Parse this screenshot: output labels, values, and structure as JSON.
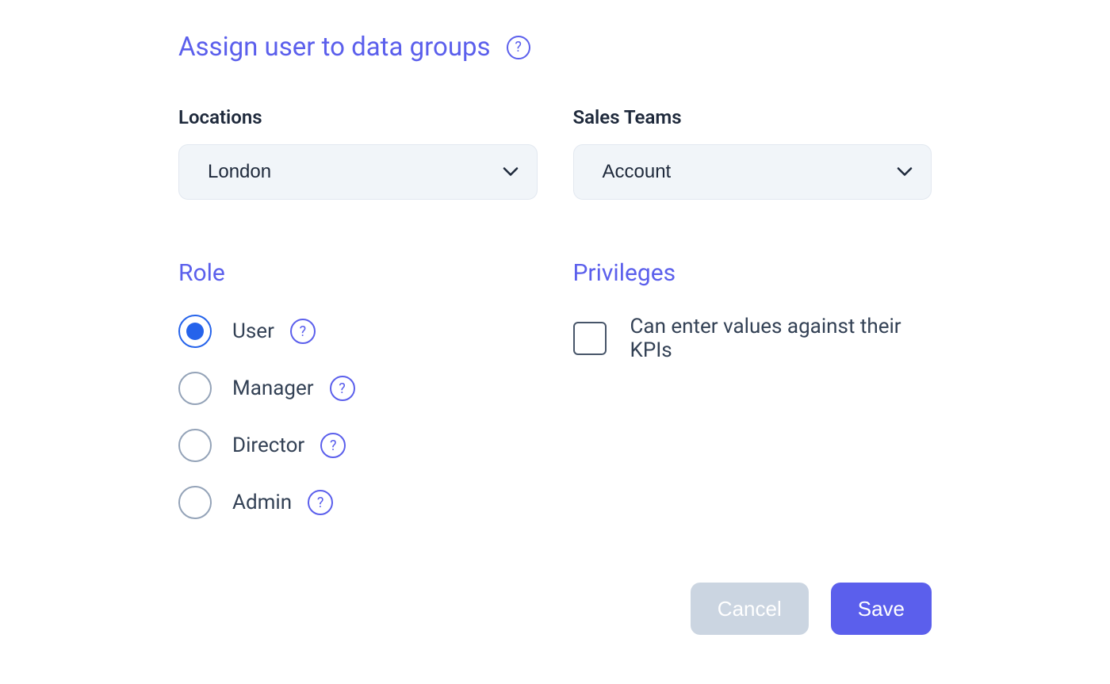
{
  "header": {
    "title": "Assign user to data groups"
  },
  "fields": {
    "locations": {
      "label": "Locations",
      "value": "London"
    },
    "salesTeams": {
      "label": "Sales Teams",
      "value": "Account"
    }
  },
  "role": {
    "title": "Role",
    "options": [
      {
        "label": "User",
        "selected": true
      },
      {
        "label": "Manager",
        "selected": false
      },
      {
        "label": "Director",
        "selected": false
      },
      {
        "label": "Admin",
        "selected": false
      }
    ]
  },
  "privileges": {
    "title": "Privileges",
    "items": [
      {
        "label": "Can enter values against their KPIs",
        "checked": false
      }
    ]
  },
  "buttons": {
    "cancel": "Cancel",
    "save": "Save"
  }
}
